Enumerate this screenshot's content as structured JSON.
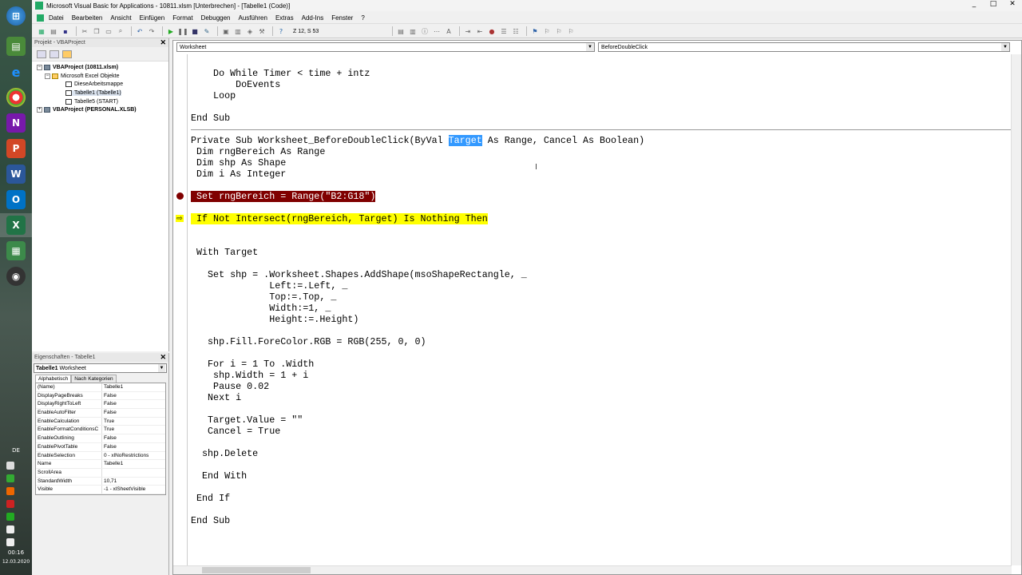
{
  "window": {
    "title": "Microsoft Visual Basic for Applications - 10811.xlsm [Unterbrechen] - [Tabelle1 (Code)]",
    "controls": [
      "_",
      "□",
      "✕"
    ]
  },
  "menu": [
    "Datei",
    "Bearbeiten",
    "Ansicht",
    "Einfügen",
    "Format",
    "Debuggen",
    "Ausführen",
    "Extras",
    "Add-Ins",
    "Fenster",
    "?"
  ],
  "toolbar": {
    "position": "Z 12, S 53"
  },
  "project_panel": {
    "title": "Projekt - VBAProject",
    "tree": [
      {
        "label": "VBAProject (10811.xlsm)",
        "bold": true
      },
      {
        "label": "Microsoft Excel Objekte",
        "bold": false
      },
      {
        "label": "DieseArbeitsmappe",
        "bold": false
      },
      {
        "label": "Tabelle1 (Tabelle1)",
        "bold": false
      },
      {
        "label": "Tabelle5 (START)",
        "bold": false
      },
      {
        "label": "VBAProject (PERSONAL.XLSB)",
        "bold": true
      }
    ]
  },
  "properties_panel": {
    "title": "Eigenschaften - Tabelle1",
    "object_bold": "Tabelle1",
    "object_type": "Worksheet",
    "tabs": [
      "Alphabetisch",
      "Nach Kategorien"
    ],
    "rows": [
      {
        "k": "(Name)",
        "v": "Tabelle1"
      },
      {
        "k": "DisplayPageBreaks",
        "v": "False"
      },
      {
        "k": "DisplayRightToLeft",
        "v": "False"
      },
      {
        "k": "EnableAutoFilter",
        "v": "False"
      },
      {
        "k": "EnableCalculation",
        "v": "True"
      },
      {
        "k": "EnableFormatConditionsC",
        "v": "True"
      },
      {
        "k": "EnableOutlining",
        "v": "False"
      },
      {
        "k": "EnablePivotTable",
        "v": "False"
      },
      {
        "k": "EnableSelection",
        "v": "0 - xlNoRestrictions"
      },
      {
        "k": "Name",
        "v": "Tabelle1"
      },
      {
        "k": "ScrollArea",
        "v": ""
      },
      {
        "k": "StandardWidth",
        "v": "10,71"
      },
      {
        "k": "Visible",
        "v": "-1 - xlSheetVisible"
      }
    ]
  },
  "code_window": {
    "object_combo": "Worksheet",
    "proc_combo": "BeforeDoubleClick",
    "lines": [
      "    Do While Timer < time + intz",
      "        DoEvents",
      "    Loop",
      "",
      "End Sub",
      "",
      "Private Sub Worksheet_BeforeDoubleClick(ByVal Target As Range, Cancel As Boolean)",
      " Dim rngBereich As Range",
      " Dim shp As Shape",
      " Dim i As Integer",
      "",
      " Set rngBereich = Range(\"B2:G18\")",
      "",
      " If Not Intersect(rngBereich, Target) Is Nothing Then",
      "",
      "",
      " With Target",
      "",
      "   Set shp = .Worksheet.Shapes.AddShape(msoShapeRectangle, _",
      "              Left:=.Left, _",
      "              Top:=.Top, _",
      "              Width:=1, _",
      "              Height:=.Height)",
      "",
      "   shp.Fill.ForeColor.RGB = RGB(255, 0, 0)",
      "",
      "   For i = 1 To .Width",
      "    shp.Width = 1 + i",
      "    Pause 0.02",
      "   Next i",
      "",
      "   Target.Value = \"\"",
      "   Cancel = True",
      "",
      "  shp.Delete",
      "",
      "  End With",
      "",
      " End If",
      "",
      "End Sub"
    ],
    "breakpoint_line": 11,
    "current_line": 13,
    "selected_word": "Target"
  },
  "system_tray": {
    "lang": "DE",
    "time": "00:16",
    "date": "12.03.2020"
  }
}
